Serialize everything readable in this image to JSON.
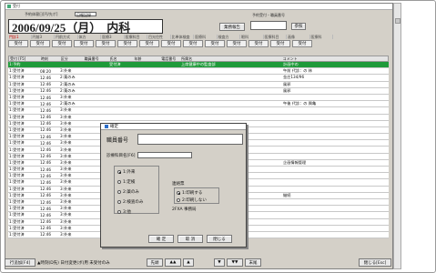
{
  "window": {
    "title": "受付"
  },
  "header": {
    "date_label": "予約体寝日[円/先ポ]",
    "mode_label": "日報記録",
    "date_text": "2006/09/25（月）",
    "dept": "内科",
    "report_button": "業務報告",
    "info_label": "予約受付・職員番号",
    "ref_button": "参照"
  },
  "tabs": [
    "門診1",
    "円前3",
    "円前方式",
    "体方",
    "医療3",
    "医療科目",
    "目光住性",
    "比単体検査",
    "医療科",
    "検査方",
    "眼科",
    "医療科目",
    "画像",
    "医療科"
  ],
  "record_buttons": [
    "受付",
    "受付",
    "受付",
    "受付",
    "受付",
    "受付",
    "受付",
    "受付",
    "受付",
    "受付",
    "受付",
    "受付",
    "受付",
    "受付"
  ],
  "table": {
    "headers": [
      "受付 [F5]",
      "時刻",
      "区分",
      "職員番号",
      "氏名",
      "年齢",
      "電話番号",
      "所属名",
      "",
      "コメント"
    ],
    "rows": [
      [
        "1:予約",
        "",
        "",
        "",
        "",
        "",
        "",
        "",
        "",
        ""
      ],
      [
        "1:受付済",
        "08:20",
        "3:外来",
        "",
        "",
        "",
        "",
        "",
        "",
        "午前 代診：の 林"
      ],
      [
        "1:受付済",
        "12:46",
        "2:薬のみ",
        "",
        "",
        "",
        "",
        "",
        "",
        "金庄134/96"
      ],
      [
        "1:受付済",
        "12:46",
        "2:薬のみ",
        "",
        "",
        "",
        "",
        "",
        "",
        "風邪"
      ],
      [
        "1:受付済",
        "12:46",
        "2:薬のみ",
        "",
        "",
        "",
        "",
        "",
        "",
        "風邪"
      ],
      [
        "1:受付済",
        "12:46",
        "3:外来",
        "",
        "",
        "",
        "",
        "",
        "",
        ""
      ],
      [
        "1:受付済",
        "12:46",
        "2:薬のみ",
        "",
        "",
        "",
        "",
        "",
        "",
        "午後 代診：の 興亀"
      ],
      [
        "1:受付済",
        "12:46",
        "3:外来",
        "",
        "",
        "",
        "",
        "",
        "",
        ""
      ],
      [
        "1:受付済",
        "12:46",
        "3:外来",
        "",
        "",
        "",
        "",
        "",
        "",
        ""
      ],
      [
        "1:受付済",
        "12:46",
        "3:外来",
        "",
        "",
        "",
        "",
        "",
        "",
        ""
      ],
      [
        "1:受付済",
        "12:46",
        "3:外来",
        "",
        "",
        "",
        "",
        "",
        "",
        ""
      ],
      [
        "1:受付済",
        "12:46",
        "3:外来",
        "",
        "",
        "",
        "",
        "",
        "",
        ""
      ],
      [
        "1:受付済",
        "12:46",
        "3:外来",
        "",
        "",
        "",
        "",
        "",
        "",
        ""
      ],
      [
        "1:受付済",
        "12:46",
        "3:外来",
        "",
        "",
        "",
        "",
        "",
        "",
        ""
      ],
      [
        "1:受付済",
        "12:46",
        "3:外来",
        "",
        "",
        "",
        "",
        "",
        "",
        ""
      ],
      [
        "1:受付済",
        "12:46",
        "3:外来",
        "",
        "",
        "",
        "",
        "",
        "",
        "企画情報管理"
      ],
      [
        "1:受付済",
        "12:46",
        "3:外来",
        "",
        "",
        "",
        "",
        "",
        "",
        ""
      ],
      [
        "1:受付済",
        "12:46",
        "3:外来",
        "",
        "",
        "",
        "",
        "",
        "",
        ""
      ],
      [
        "1:受付済",
        "12:46",
        "3:外来",
        "",
        "",
        "",
        "",
        "",
        "",
        ""
      ],
      [
        "1:受付済",
        "12:46",
        "3:外来",
        "",
        "",
        "",
        "",
        "",
        "",
        ""
      ],
      [
        "1:受付済",
        "12:46",
        "3:外来",
        "",
        "",
        "",
        "",
        "",
        "",
        "継続"
      ],
      [
        "1:受付済",
        "12:46",
        "3:外来",
        "",
        "",
        "",
        "",
        "",
        "",
        ""
      ],
      [
        "1:受付済",
        "12:46",
        "3:外来",
        "",
        "",
        "",
        "",
        "",
        "",
        ""
      ],
      [
        "1:受付済",
        "12:46",
        "3:外来",
        "",
        "",
        "",
        "",
        "",
        "",
        ""
      ],
      [
        "1:受付済",
        "12:46",
        "3:外来",
        "",
        "",
        "",
        "",
        "",
        "",
        ""
      ],
      [
        "1:受付済",
        "12:46",
        "3:外来",
        "",
        "",
        "",
        "",
        "",
        "",
        ""
      ],
      [
        "1:受付済",
        "12:46",
        "3:外来",
        "",
        "",
        "",
        "",
        "",
        "",
        ""
      ]
    ],
    "selected_row_fragments": {
      "status": "1:予約",
      "name": "受付済",
      "affiliation": "上席健康中の監査部",
      "comment": "計画中の"
    }
  },
  "dialog": {
    "title": "確定",
    "field_label": "職員番号",
    "subject_label": "診療科目名[F6]",
    "options": [
      "1:外来",
      "1:定検",
      "2:薬のみ",
      "2:検査のみ",
      "3:他"
    ],
    "selected_option": 0,
    "contact_label": "連絡票",
    "contact_options": [
      "1:印刷する",
      "2:印刷しない"
    ],
    "contact_selected": 0,
    "note": "2FXA 事務局",
    "buttons": [
      "確 定",
      "取 消",
      "閉じる"
    ]
  },
  "footer": {
    "left_button": "行追加[F4]",
    "info_text": "▲時刻(D先) 日付変更(ボ)用 未受付のみ",
    "nav_top": "先頭",
    "nav_up2": "▲▲",
    "nav_up": "▲",
    "nav_down": "▼",
    "nav_down2": "▼▼",
    "nav_end": "末尾",
    "close_button": "閉じる[Esc]"
  }
}
